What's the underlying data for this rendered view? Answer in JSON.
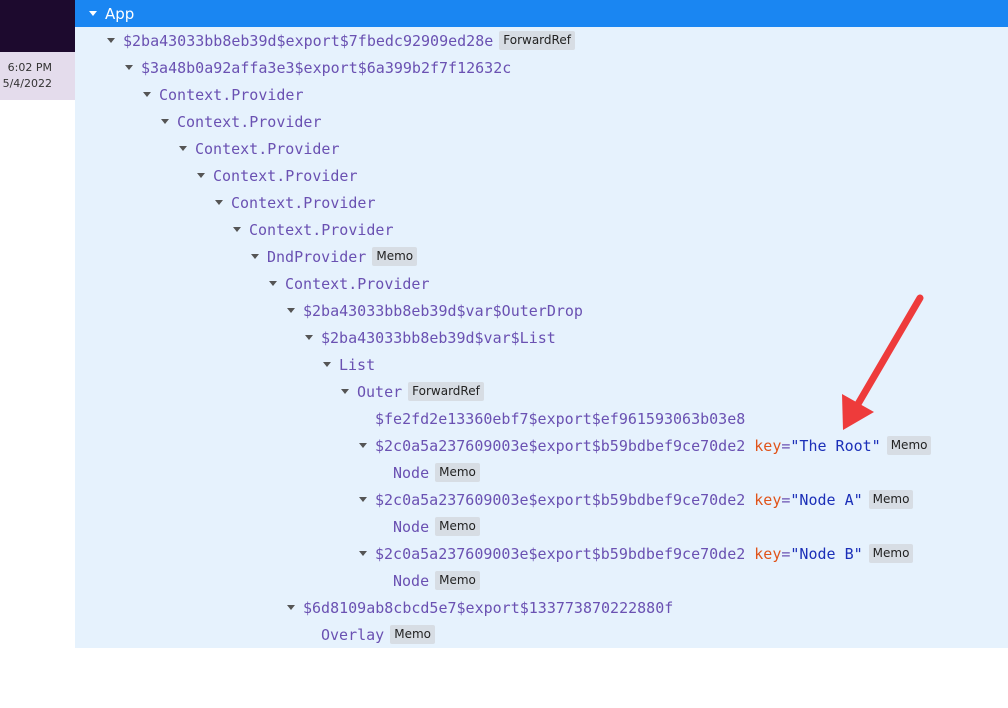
{
  "taskbar": {
    "time": "6:02 PM",
    "date": "5/4/2022"
  },
  "tree": {
    "rows": [
      {
        "label": "App"
      },
      {
        "label": "$2ba43033bb8eb39d$export$7fbedc92909ed28e",
        "badge": "ForwardRef"
      },
      {
        "label": "$3a48b0a92affa3e3$export$6a399b2f7f12632c"
      },
      {
        "label": "Context.Provider"
      },
      {
        "label": "Context.Provider"
      },
      {
        "label": "Context.Provider"
      },
      {
        "label": "Context.Provider"
      },
      {
        "label": "Context.Provider"
      },
      {
        "label": "Context.Provider"
      },
      {
        "label": "DndProvider",
        "badge": "Memo"
      },
      {
        "label": "Context.Provider"
      },
      {
        "label": "$2ba43033bb8eb39d$var$OuterDrop"
      },
      {
        "label": "$2ba43033bb8eb39d$var$List"
      },
      {
        "label": "List"
      },
      {
        "label": "Outer",
        "badge": "ForwardRef"
      },
      {
        "label": "$fe2fd2e13360ebf7$export$ef961593063b03e8"
      },
      {
        "label": "$2c0a5a237609003e$export$b59bdbef9ce70de2",
        "key_name": "key",
        "key_eq": "=",
        "key_value": "\"The Root\"",
        "badge": "Memo"
      },
      {
        "label": "Node",
        "badge": "Memo"
      },
      {
        "label": "$2c0a5a237609003e$export$b59bdbef9ce70de2",
        "key_name": "key",
        "key_eq": "=",
        "key_value": "\"Node A\"",
        "badge": "Memo"
      },
      {
        "label": "Node",
        "badge": "Memo"
      },
      {
        "label": "$2c0a5a237609003e$export$b59bdbef9ce70de2",
        "key_name": "key",
        "key_eq": "=",
        "key_value": "\"Node B\"",
        "badge": "Memo"
      },
      {
        "label": "Node",
        "badge": "Memo"
      },
      {
        "label": "$6d8109ab8cbcd5e7$export$133773870222880f"
      },
      {
        "label": "Overlay",
        "badge": "Memo"
      }
    ]
  },
  "colors": {
    "selected_row": "#1a86f2",
    "tree_background": "#e6f2fd",
    "component_name": "#6a51b2",
    "key_name": "#e0541a",
    "key_value": "#1b2fb8",
    "annotation_arrow": "#ee3b3b"
  }
}
